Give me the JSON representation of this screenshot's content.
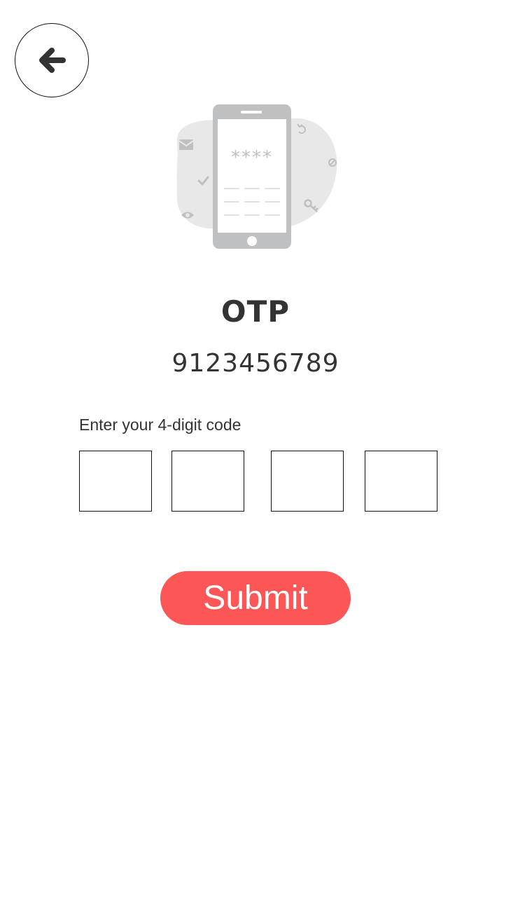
{
  "header": {
    "back_icon": "arrow-left-icon"
  },
  "illustration": {
    "masked_code": "****",
    "icons": [
      "envelope-icon",
      "check-icon",
      "eye-icon",
      "refresh-icon",
      "block-icon",
      "key-icon"
    ]
  },
  "main": {
    "title": "OTP",
    "phone_number": "9123456789",
    "instruction": "Enter your 4-digit code",
    "otp_digits": [
      "",
      "",
      "",
      ""
    ]
  },
  "actions": {
    "submit_label": "Submit"
  },
  "colors": {
    "accent": "#fc5656",
    "text": "#333333",
    "illustration_gray": "#bfc0c2",
    "blob": "#e8e8e9"
  }
}
